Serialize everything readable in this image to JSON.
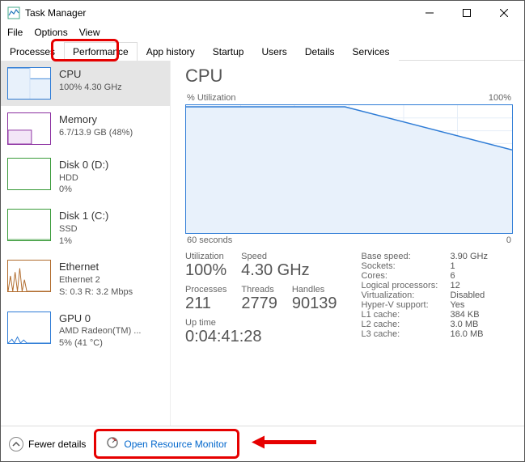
{
  "window": {
    "title": "Task Manager"
  },
  "menu": {
    "file": "File",
    "options": "Options",
    "view": "View"
  },
  "tabs": {
    "processes": "Processes",
    "performance": "Performance",
    "appHistory": "App history",
    "startup": "Startup",
    "users": "Users",
    "details": "Details",
    "services": "Services"
  },
  "sidebar": {
    "cpu": {
      "title": "CPU",
      "sub": "100%  4.30 GHz"
    },
    "memory": {
      "title": "Memory",
      "sub": "6.7/13.9 GB (48%)"
    },
    "disk0": {
      "title": "Disk 0 (D:)",
      "sub1": "HDD",
      "sub2": "0%"
    },
    "disk1": {
      "title": "Disk 1 (C:)",
      "sub1": "SSD",
      "sub2": "1%"
    },
    "ethernet": {
      "title": "Ethernet",
      "sub1": "Ethernet 2",
      "sub2": "S: 0.3 R: 3.2 Mbps"
    },
    "gpu": {
      "title": "GPU 0",
      "sub1": "AMD Radeon(TM) ...",
      "sub2": "5%  (41 °C)"
    }
  },
  "main": {
    "heading": "CPU",
    "chart": {
      "leftLabel": "% Utilization",
      "rightLabel": "100%",
      "footLeft": "60 seconds",
      "footRight": "0"
    },
    "stats": {
      "utilization": {
        "label": "Utilization",
        "value": "100%"
      },
      "speed": {
        "label": "Speed",
        "value": "4.30 GHz"
      },
      "processes": {
        "label": "Processes",
        "value": "211"
      },
      "threads": {
        "label": "Threads",
        "value": "2779"
      },
      "handles": {
        "label": "Handles",
        "value": "90139"
      },
      "uptime": {
        "label": "Up time",
        "value": "0:04:41:28"
      }
    },
    "info": {
      "baseSpeed": {
        "k": "Base speed:",
        "v": "3.90 GHz"
      },
      "sockets": {
        "k": "Sockets:",
        "v": "1"
      },
      "cores": {
        "k": "Cores:",
        "v": "6"
      },
      "logical": {
        "k": "Logical processors:",
        "v": "12"
      },
      "virt": {
        "k": "Virtualization:",
        "v": "Disabled"
      },
      "hyperv": {
        "k": "Hyper-V support:",
        "v": "Yes"
      },
      "l1": {
        "k": "L1 cache:",
        "v": "384 KB"
      },
      "l2": {
        "k": "L2 cache:",
        "v": "3.0 MB"
      },
      "l3": {
        "k": "L3 cache:",
        "v": "16.0 MB"
      }
    }
  },
  "footer": {
    "fewer": "Fewer details",
    "orm": "Open Resource Monitor"
  },
  "chart_data": {
    "type": "line",
    "title": "% Utilization",
    "xlabel": "60 seconds",
    "ylabel": "% Utilization",
    "ylim": [
      0,
      100
    ],
    "x": [
      60,
      30,
      0
    ],
    "values": [
      100,
      100,
      65
    ],
    "note": "Approximate readout: CPU held ~100% for ~30s then ramped down to ~65%."
  }
}
